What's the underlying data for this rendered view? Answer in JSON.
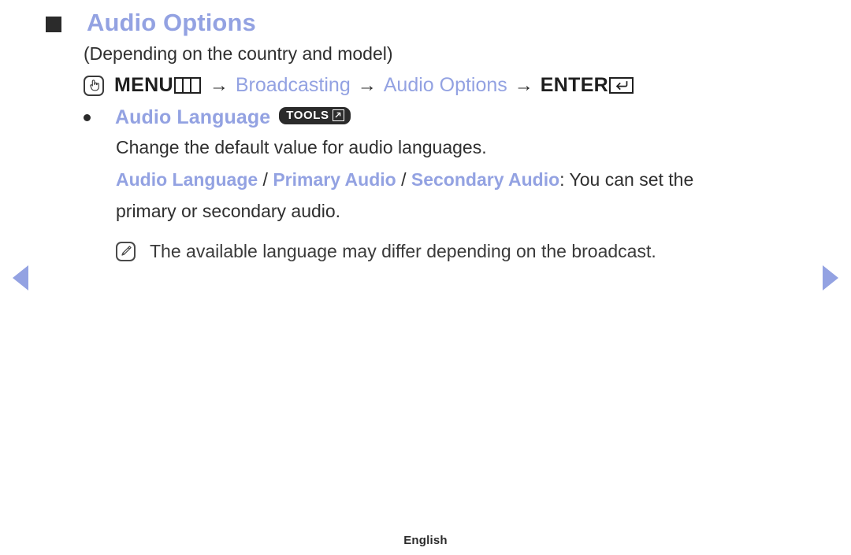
{
  "heading": {
    "bullet_icon": "square-bullet-icon",
    "title": "Audio Options"
  },
  "subtitle": "(Depending on the country and model)",
  "menu_path": {
    "remote_icon": "remote-hand-pointer-icon",
    "menu_label": "MENU",
    "menu_icon": "menu-grid-icon",
    "arrow1": "→",
    "step1": "Broadcasting",
    "arrow2": "→",
    "step2": "Audio Options",
    "arrow3": "→",
    "enter_label": "ENTER",
    "enter_icon": "enter-return-icon"
  },
  "option": {
    "bullet_icon": "dot-bullet-icon",
    "label": "Audio Language",
    "tools_badge_label": "TOOLS",
    "tools_badge_icon": "tools-arrow-icon",
    "description": "Change the default value for audio languages.",
    "detail": {
      "term1": "Audio Language",
      "separator1": " / ",
      "term2": "Primary Audio",
      "separator2": " / ",
      "term3": "Secondary Audio",
      "tail": ": You can set the",
      "line2": "primary or secondary audio."
    }
  },
  "note": {
    "icon": "note-pencil-icon",
    "text": "The available language may differ depending on the broadcast."
  },
  "navigation": {
    "prev_icon": "previous-page-arrow-icon",
    "next_icon": "next-page-arrow-icon"
  },
  "footer": {
    "language": "English"
  },
  "colors": {
    "accent": "#93a2e2",
    "text": "#2f2f2f",
    "badge_background": "#2b2b2b",
    "background": "#ffffff"
  }
}
